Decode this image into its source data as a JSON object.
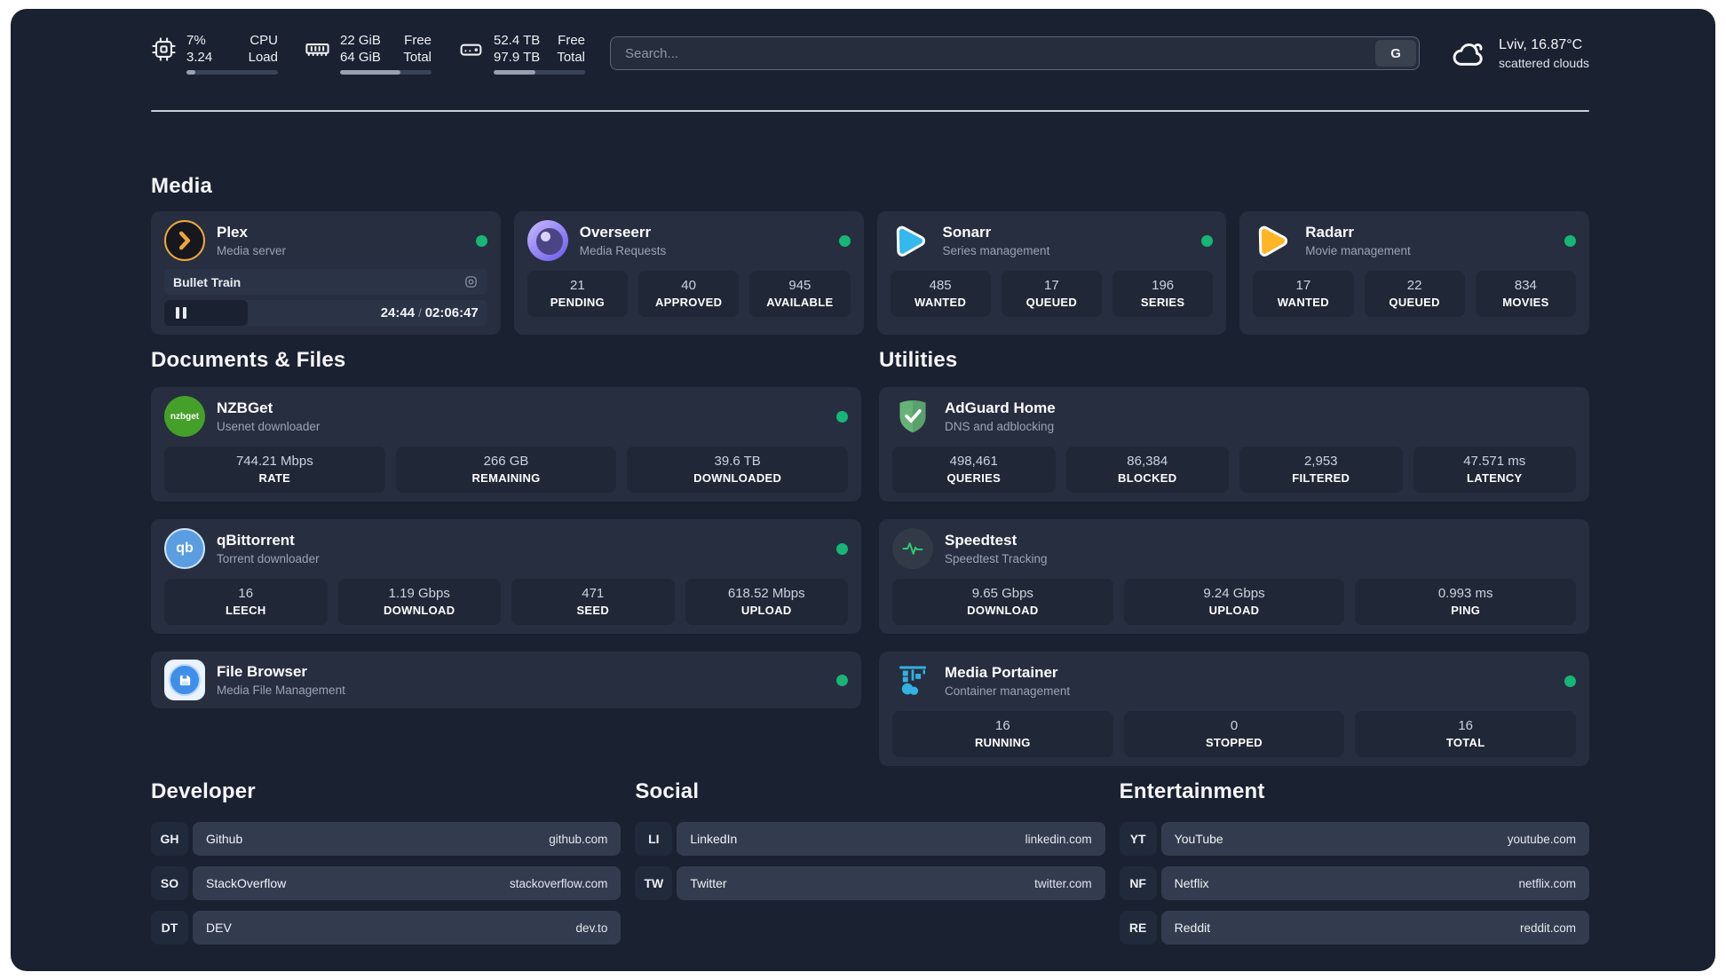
{
  "header": {
    "system": {
      "cpu": {
        "line1_value": "7%",
        "line2_value": "3.24",
        "line1_label": "CPU",
        "line2_label": "Load",
        "progress": 10
      },
      "memory": {
        "line1_value": "22 GiB",
        "line2_value": "64 GiB",
        "line1_label": "Free",
        "line2_label": "Total",
        "progress": 66
      },
      "disk": {
        "line1_value": "52.4 TB",
        "line2_value": "97.9 TB",
        "line1_label": "Free",
        "line2_label": "Total",
        "progress": 46
      }
    },
    "search": {
      "placeholder": "Search...",
      "engine_button": "G"
    },
    "weather": {
      "location": "Lviv, 16.87°C",
      "condition": "scattered clouds"
    }
  },
  "sections": {
    "media": "Media",
    "documents": "Documents & Files",
    "utilities": "Utilities",
    "developer": "Developer",
    "social": "Social",
    "entertainment": "Entertainment"
  },
  "apps": {
    "plex": {
      "name": "Plex",
      "description": "Media server",
      "now_playing": {
        "title": "Bullet Train",
        "time_current": "24:44",
        "time_separator": "/",
        "time_total": "02:06:47"
      }
    },
    "overseerr": {
      "name": "Overseerr",
      "description": "Media Requests",
      "stats": [
        {
          "value": "21",
          "label": "PENDING"
        },
        {
          "value": "40",
          "label": "APPROVED"
        },
        {
          "value": "945",
          "label": "AVAILABLE"
        }
      ]
    },
    "sonarr": {
      "name": "Sonarr",
      "description": "Series management",
      "stats": [
        {
          "value": "485",
          "label": "WANTED"
        },
        {
          "value": "17",
          "label": "QUEUED"
        },
        {
          "value": "196",
          "label": "SERIES"
        }
      ]
    },
    "radarr": {
      "name": "Radarr",
      "description": "Movie management",
      "stats": [
        {
          "value": "17",
          "label": "WANTED"
        },
        {
          "value": "22",
          "label": "QUEUED"
        },
        {
          "value": "834",
          "label": "MOVIES"
        }
      ]
    },
    "nzbget": {
      "name": "NZBGet",
      "description": "Usenet downloader",
      "icon_text": "nzbget",
      "stats": [
        {
          "value": "744.21 Mbps",
          "label": "RATE"
        },
        {
          "value": "266 GB",
          "label": "REMAINING"
        },
        {
          "value": "39.6 TB",
          "label": "DOWNLOADED"
        }
      ]
    },
    "qbittorrent": {
      "name": "qBittorrent",
      "description": "Torrent downloader",
      "icon_text": "qb",
      "stats": [
        {
          "value": "16",
          "label": "LEECH"
        },
        {
          "value": "1.19 Gbps",
          "label": "DOWNLOAD"
        },
        {
          "value": "471",
          "label": "SEED"
        },
        {
          "value": "618.52 Mbps",
          "label": "UPLOAD"
        }
      ]
    },
    "filebrowser": {
      "name": "File Browser",
      "description": "Media File Management"
    },
    "adguard": {
      "name": "AdGuard Home",
      "description": "DNS and adblocking",
      "stats": [
        {
          "value": "498,461",
          "label": "QUERIES"
        },
        {
          "value": "86,384",
          "label": "BLOCKED"
        },
        {
          "value": "2,953",
          "label": "FILTERED"
        },
        {
          "value": "47.571 ms",
          "label": "LATENCY"
        }
      ]
    },
    "speedtest": {
      "name": "Speedtest",
      "description": "Speedtest Tracking",
      "stats": [
        {
          "value": "9.65 Gbps",
          "label": "DOWNLOAD"
        },
        {
          "value": "9.24 Gbps",
          "label": "UPLOAD"
        },
        {
          "value": "0.993 ms",
          "label": "PING"
        }
      ]
    },
    "portainer": {
      "name": "Media Portainer",
      "description": "Container management",
      "stats": [
        {
          "value": "16",
          "label": "RUNNING"
        },
        {
          "value": "0",
          "label": "STOPPED"
        },
        {
          "value": "16",
          "label": "TOTAL"
        }
      ]
    }
  },
  "links": {
    "developer": [
      {
        "abbr": "GH",
        "name": "Github",
        "url": "github.com"
      },
      {
        "abbr": "SO",
        "name": "StackOverflow",
        "url": "stackoverflow.com"
      },
      {
        "abbr": "DT",
        "name": "DEV",
        "url": "dev.to"
      }
    ],
    "social": [
      {
        "abbr": "LI",
        "name": "LinkedIn",
        "url": "linkedin.com"
      },
      {
        "abbr": "TW",
        "name": "Twitter",
        "url": "twitter.com"
      }
    ],
    "entertainment": [
      {
        "abbr": "YT",
        "name": "YouTube",
        "url": "youtube.com"
      },
      {
        "abbr": "NF",
        "name": "Netflix",
        "url": "netflix.com"
      },
      {
        "abbr": "RE",
        "name": "Reddit",
        "url": "reddit.com"
      }
    ]
  },
  "colors": {
    "status_online": "#17b576",
    "background": "#1a2130",
    "card": "#272e3f",
    "accent_plex": "#f0a43c",
    "accent_sonarr": "#35b8ee",
    "accent_radarr": "#ffb626",
    "accent_adguard": "#67b279",
    "accent_portainer": "#33b1e0"
  }
}
